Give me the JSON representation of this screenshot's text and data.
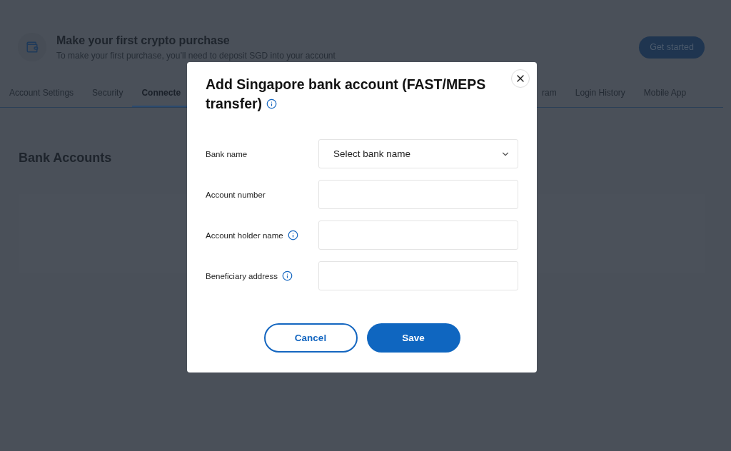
{
  "banner": {
    "title": "Make your first crypto purchase",
    "subtitle": "To make your first purchase, you’ll need to deposit SGD into your account",
    "button": "Get started"
  },
  "tabs": [
    {
      "label": "Account Settings",
      "selected": false
    },
    {
      "label": "Security",
      "selected": false
    },
    {
      "label": "Connecte",
      "selected": true
    },
    {
      "label": "ram",
      "selected": false
    },
    {
      "label": "Login History",
      "selected": false
    },
    {
      "label": "Mobile App",
      "selected": false
    }
  ],
  "section": {
    "title": "Bank Accounts"
  },
  "dialog": {
    "title": "Add Singapore bank account (FAST/MEPS transfer)",
    "fields": [
      {
        "label": "Bank name",
        "kind": "select",
        "value": "Select bank name",
        "info": false
      },
      {
        "label": "Account number",
        "kind": "text",
        "info": false
      },
      {
        "label": "Account holder name",
        "kind": "text",
        "info": true
      },
      {
        "label": "Beneficiary address",
        "kind": "text",
        "info": true
      }
    ],
    "cancel": "Cancel",
    "save": "Save"
  }
}
